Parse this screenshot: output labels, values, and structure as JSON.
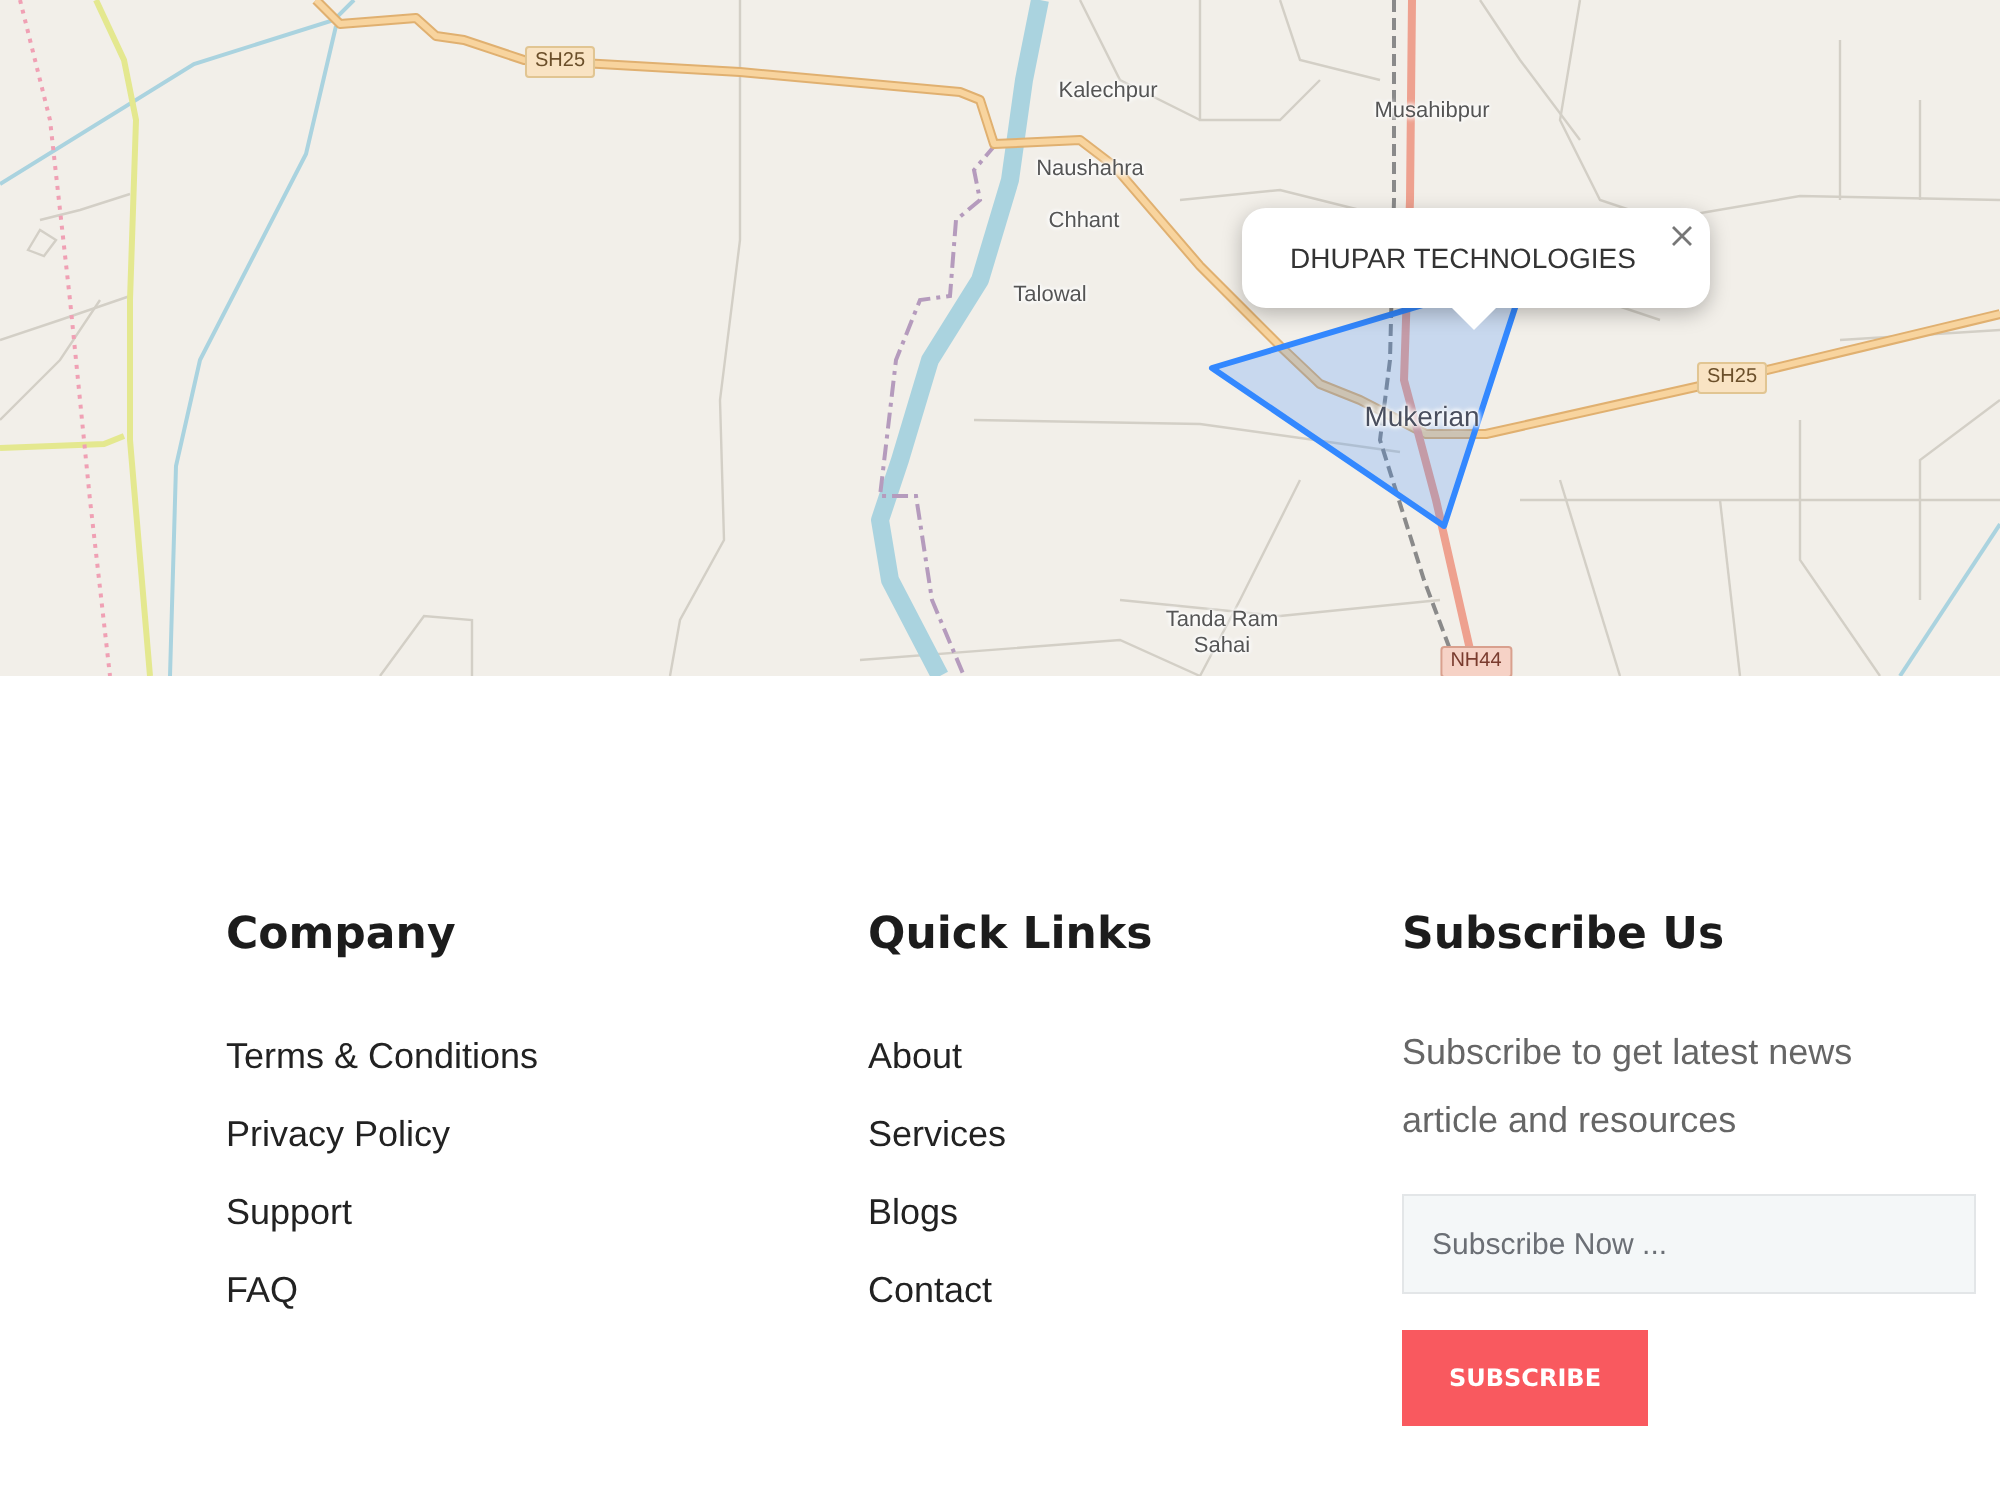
{
  "map": {
    "places": [
      {
        "kind": "village",
        "label": "Kalechpur"
      },
      {
        "kind": "village",
        "label": "Musahibpur"
      },
      {
        "kind": "village",
        "label": "Naushahra"
      },
      {
        "kind": "village",
        "label": "Chhant"
      },
      {
        "kind": "village",
        "label": "Talowal"
      },
      {
        "kind": "town",
        "label": "Mukerian"
      },
      {
        "kind": "village",
        "label": "Tanda Ram Sahai"
      }
    ],
    "road_shields": [
      {
        "kind": "state",
        "label": "SH25"
      },
      {
        "kind": "state",
        "label": "SH25"
      },
      {
        "kind": "national",
        "label": "NH44"
      }
    ],
    "popup": {
      "title": "DHUPAR TECHNOLOGIES"
    }
  },
  "footer": {
    "columns": [
      {
        "kind": "links",
        "heading": "Company",
        "links": [
          "Terms & Conditions",
          "Privacy Policy",
          "Support",
          "FAQ"
        ]
      },
      {
        "kind": "links",
        "heading": "Quick Links",
        "links": [
          "About",
          "Services",
          "Blogs",
          "Contact"
        ]
      },
      {
        "kind": "subscribe",
        "heading": "Subscribe Us",
        "text": "Subscribe to get latest news article and resources",
        "placeholder": "Subscribe Now ...",
        "button": "SUBSCRIBE"
      }
    ]
  }
}
